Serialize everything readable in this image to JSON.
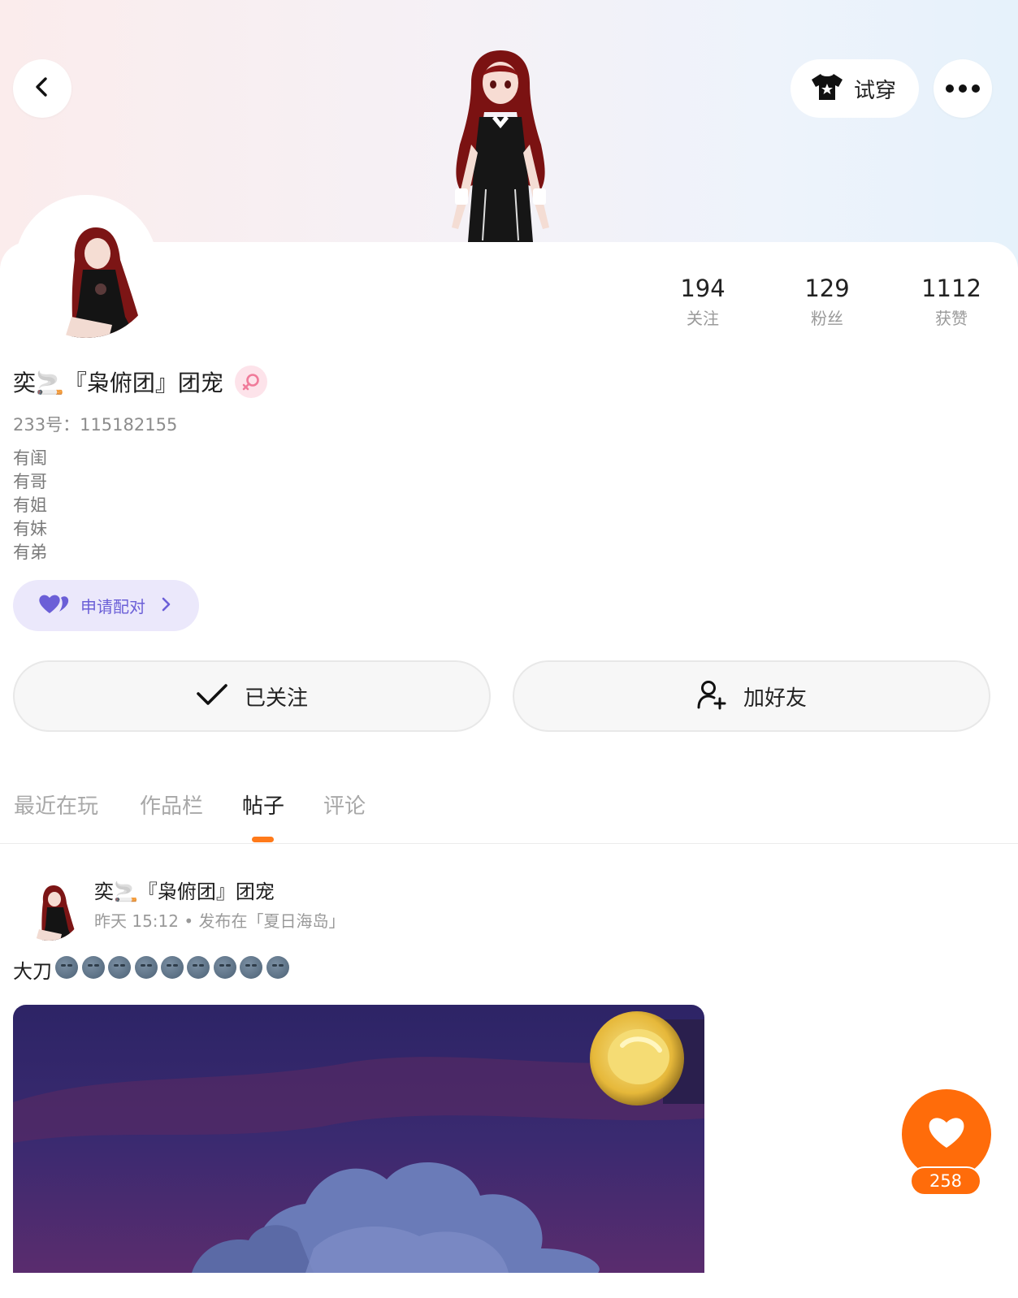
{
  "header": {
    "try_on_label": "试穿",
    "icons": {
      "back": "chevron-left-icon",
      "try_on": "tshirt-icon",
      "more": "more-dots-icon"
    }
  },
  "stats": [
    {
      "num": "194",
      "label": "关注"
    },
    {
      "num": "129",
      "label": "粉丝"
    },
    {
      "num": "1112",
      "label": "获赞"
    }
  ],
  "profile": {
    "name": "奕🚬『枭俯团』团宠",
    "uid_line": "233号：115182155",
    "bio": [
      "有闺",
      "有哥",
      "有姐",
      "有妹",
      "有弟"
    ],
    "gender_icon": "female-symbol-icon"
  },
  "pair_button": {
    "label": "申请配对",
    "icon": "purple-heart-icon"
  },
  "actions": {
    "following_label": "已关注",
    "add_friend_label": "加好友"
  },
  "tabs": [
    {
      "label": "最近在玩",
      "active": false
    },
    {
      "label": "作品栏",
      "active": false
    },
    {
      "label": "帖子",
      "active": true
    },
    {
      "label": "评论",
      "active": false
    }
  ],
  "post": {
    "author": "奕🚬『枭俯团』团宠",
    "meta": "昨天 15:12 • 发布在「夏日海岛」",
    "text": "大刀",
    "emoji_count": 9,
    "emoji_name": "moon-face-emoji"
  },
  "like": {
    "count": "258"
  },
  "colors": {
    "accent": "#ff6c0a",
    "pair_purple": "#6b5fd7",
    "pair_bg": "#ebe8fb"
  }
}
